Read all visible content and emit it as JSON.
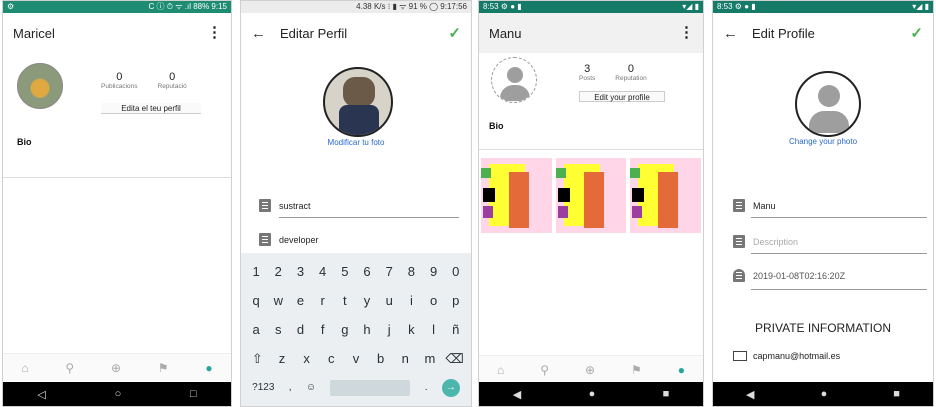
{
  "screens": [
    {
      "status": {
        "left": "⚙",
        "right": "C ⓘ ⏱ ᯤ .ıl 88% 9:15"
      },
      "title": "Maricel",
      "stats": [
        {
          "value": "0",
          "label": "Publicacions"
        },
        {
          "value": "0",
          "label": "Reputació"
        }
      ],
      "edit_button": "Edita el teu perfil",
      "bio_label": "Bio",
      "nav_icons": [
        "home-icon",
        "search-icon",
        "add-icon",
        "location-icon",
        "person-icon"
      ]
    },
    {
      "status": {
        "left": "",
        "right": "4.38 K/s ⁝ ▮ ᯤ 91 % ◯ 9:17:56"
      },
      "title": "Editar Perfil",
      "photo_link": "Modificar tu foto",
      "fields": [
        {
          "value": "sustract"
        },
        {
          "value": "developer"
        }
      ],
      "keyboard": {
        "row1": [
          "1",
          "2",
          "3",
          "4",
          "5",
          "6",
          "7",
          "8",
          "9",
          "0"
        ],
        "row2": [
          "q",
          "w",
          "e",
          "r",
          "t",
          "y",
          "u",
          "i",
          "o",
          "p"
        ],
        "row3": [
          "a",
          "s",
          "d",
          "f",
          "g",
          "h",
          "j",
          "k",
          "l",
          "ñ"
        ],
        "row4": [
          "⇧",
          "z",
          "x",
          "c",
          "v",
          "b",
          "n",
          "m",
          "⌫"
        ],
        "row5": {
          "left": "?123",
          "comma": ",",
          "emoji": "☺",
          "period": ".",
          "enter": "→"
        }
      }
    },
    {
      "status": {
        "left": "8:53 ⚙ ● ▮",
        "right": "▾◢ ▮"
      },
      "title": "Manu",
      "stats": [
        {
          "value": "3",
          "label": "Posts"
        },
        {
          "value": "0",
          "label": "Reputation"
        }
      ],
      "edit_button": "Edit your profile",
      "bio_label": "Bio"
    },
    {
      "status": {
        "left": "8:53 ⚙ ● ▮",
        "right": "▾◢ ▮"
      },
      "title": "Edit Profile",
      "photo_link": "Change your photo",
      "fields": [
        {
          "value": "Manu"
        },
        {
          "placeholder": "Description"
        },
        {
          "value": "2019-01-08T02:16:20Z"
        }
      ],
      "section_title": "PRIVATE INFORMATION",
      "email": "capmanu@hotmail.es"
    }
  ],
  "sysnav_icons": [
    "back-icon",
    "home-button-icon",
    "recents-icon"
  ],
  "colors": {
    "accent_teal": "#26a69a",
    "status_green": "#1e8c73",
    "check_green": "#4caf50",
    "link_blue": "#2a68c9"
  }
}
